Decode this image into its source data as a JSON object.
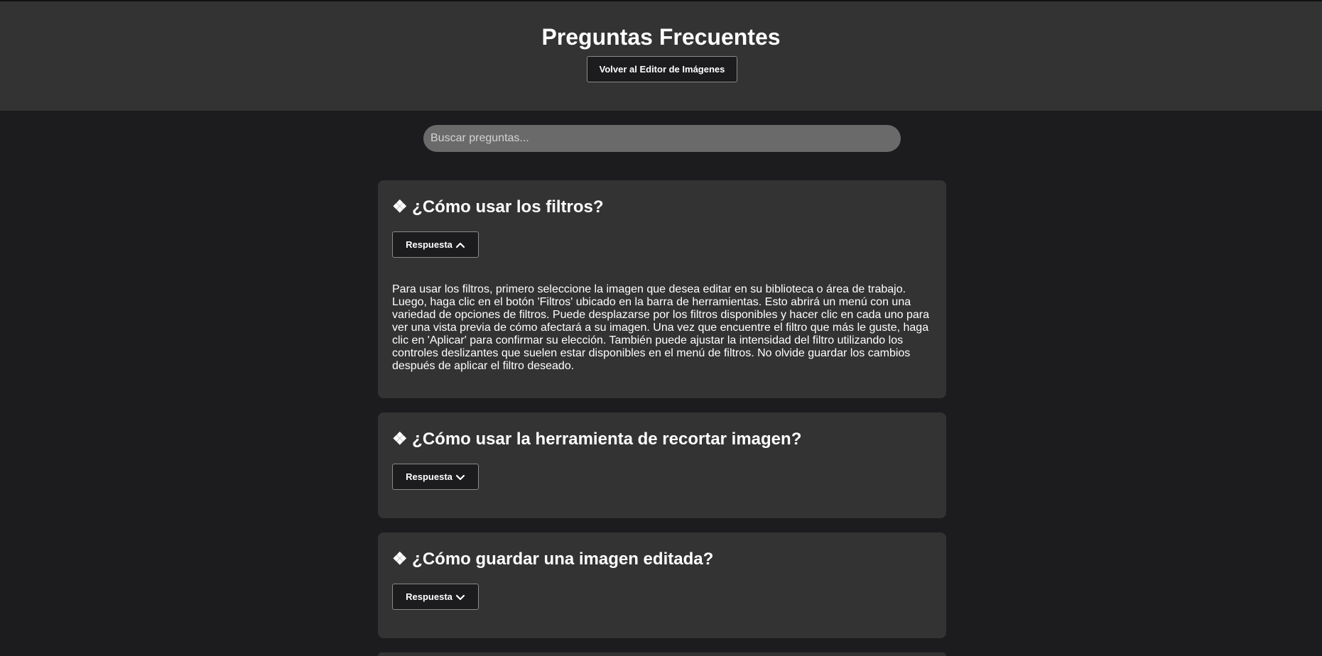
{
  "header": {
    "title": "Preguntas Frecuentes",
    "back_button_label": "Volver al Editor de Imágenes"
  },
  "search": {
    "placeholder": "Buscar preguntas...",
    "value": ""
  },
  "faqs": [
    {
      "question": "❖ ¿Cómo usar los filtros?",
      "toggle_label": "Respuesta",
      "toggle_icon": "chevron-up-icon",
      "expanded": true,
      "answer": "Para usar los filtros, primero seleccione la imagen que desea editar en su biblioteca o área de trabajo. Luego, haga clic en el botón 'Filtros' ubicado en la barra de herramientas. Esto abrirá un menú con una variedad de opciones de filtros. Puede desplazarse por los filtros disponibles y hacer clic en cada uno para ver una vista previa de cómo afectará a su imagen. Una vez que encuentre el filtro que más le guste, haga clic en 'Aplicar' para confirmar su elección. También puede ajustar la intensidad del filtro utilizando los controles deslizantes que suelen estar disponibles en el menú de filtros. No olvide guardar los cambios después de aplicar el filtro deseado."
    },
    {
      "question": "❖ ¿Cómo usar la herramienta de recortar imagen?",
      "toggle_label": "Respuesta",
      "toggle_icon": "chevron-down-icon",
      "expanded": false
    },
    {
      "question": "❖ ¿Cómo guardar una imagen editada?",
      "toggle_label": "Respuesta",
      "toggle_icon": "chevron-down-icon",
      "expanded": false
    }
  ],
  "colors": {
    "page_background": "#1c1c1e",
    "header_background": "#333333",
    "card_background": "#333333",
    "search_background": "#6a6a6a",
    "button_background": "#1c1c1e",
    "text": "#ffffff"
  }
}
